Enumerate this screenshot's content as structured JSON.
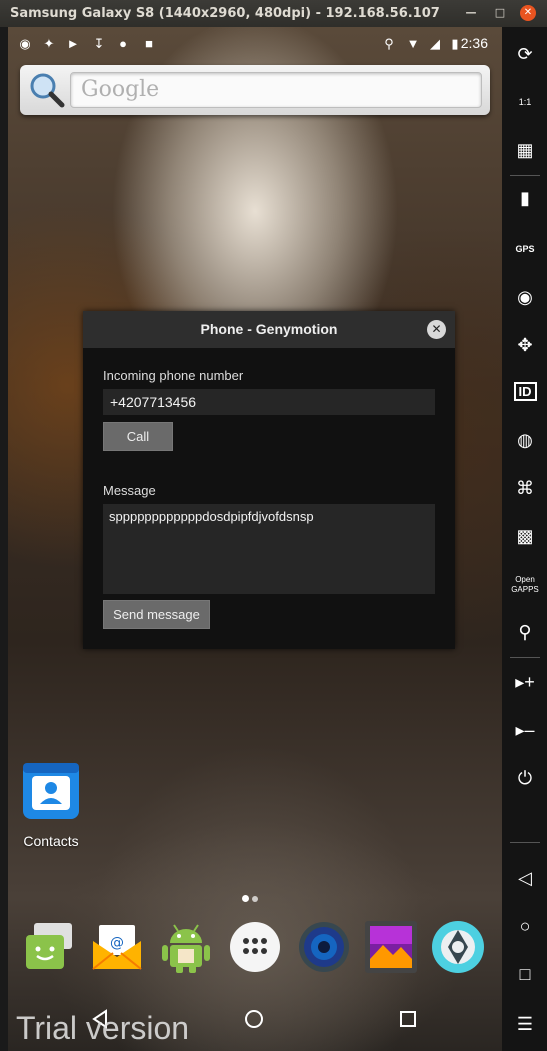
{
  "window": {
    "title": "Samsung Galaxy S8 (1440x2960, 480dpi) - 192.168.56.107 - Ge...",
    "min_icon": "minimize-icon",
    "max_icon": "maximize-icon",
    "close_icon": "close-icon"
  },
  "statusbar": {
    "time": "2:36",
    "left_icons": [
      "messenger-icon",
      "twitter-icon",
      "shield-play-icon",
      "download-icon",
      "location-icon",
      "shield-icon"
    ],
    "right_icons": [
      "key-icon",
      "wifi-icon",
      "signal-icon",
      "battery-icon"
    ]
  },
  "google_widget": {
    "placeholder": "Google"
  },
  "dialog": {
    "title": "Phone - Genymotion",
    "phone_label": "Incoming phone number",
    "phone_value": "+4207713456",
    "call_label": "Call",
    "message_label": "Message",
    "message_value": "sppppppppppppdosdpipfdjvofdsnsp",
    "send_label": "Send message"
  },
  "home": {
    "contacts_label": "Contacts",
    "dock_apps": [
      "messaging-app-icon",
      "email-app-icon",
      "android-app-icon",
      "app-drawer-icon",
      "music-app-icon",
      "gallery-app-icon",
      "camera-app-icon"
    ]
  },
  "navbar": {
    "back_icon": "back-icon",
    "home_icon": "home-icon",
    "recents_icon": "recents-icon",
    "watermark": "Trial version"
  },
  "toolbar": {
    "items": [
      "rotate-icon",
      "pixel-perfect-icon",
      "capture-icon",
      "battery-icon",
      "gps-icon",
      "webcam-icon",
      "navigation-icon",
      "identifiers-icon",
      "disk-io-icon",
      "network-icon",
      "sms-icon",
      "open-gapps-icon",
      "share-icon",
      "volume-up-icon",
      "volume-down-icon",
      "power-icon",
      "nav-back-icon",
      "nav-home-icon",
      "nav-recents-icon",
      "nav-menu-icon"
    ],
    "gps_text": "GPS",
    "id_text": "ID",
    "ratio_text": "1:1",
    "opengapps_text": "Open GAPPS"
  }
}
